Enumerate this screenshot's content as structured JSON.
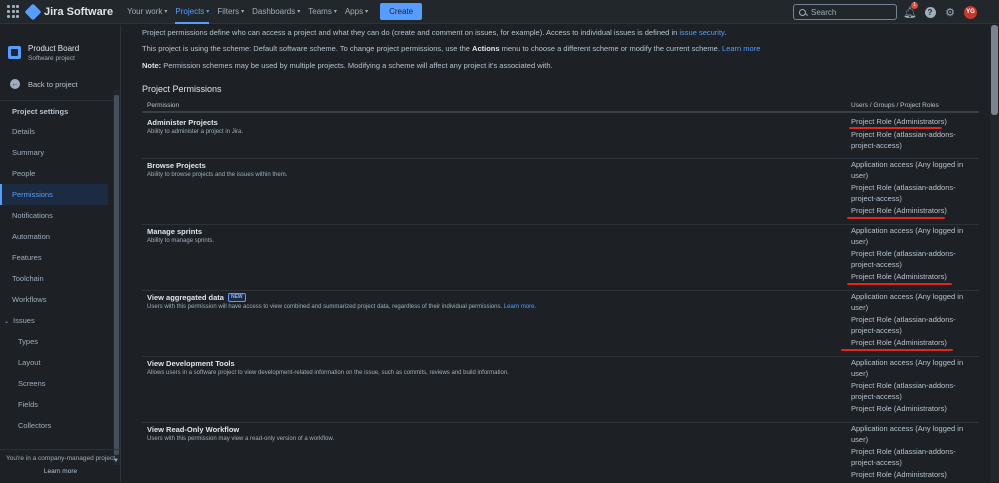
{
  "topnav": {
    "app_name": "Jira Software",
    "items": [
      {
        "label": "Your work"
      },
      {
        "label": "Projects"
      },
      {
        "label": "Filters"
      },
      {
        "label": "Dashboards"
      },
      {
        "label": "Teams"
      },
      {
        "label": "Apps"
      }
    ],
    "create_label": "Create",
    "search_placeholder": "Search",
    "notification_count": "1",
    "avatar_initials": "YG"
  },
  "sidebar": {
    "project_name": "Product Board",
    "project_type": "Software project",
    "back_label": "Back to project",
    "heading": "Project settings",
    "items": [
      {
        "label": "Details"
      },
      {
        "label": "Summary"
      },
      {
        "label": "People"
      },
      {
        "label": "Permissions"
      },
      {
        "label": "Notifications"
      },
      {
        "label": "Automation"
      },
      {
        "label": "Features"
      },
      {
        "label": "Toolchain"
      },
      {
        "label": "Workflows"
      },
      {
        "label": "Issues"
      },
      {
        "label": "Types"
      },
      {
        "label": "Layout"
      },
      {
        "label": "Screens"
      },
      {
        "label": "Fields"
      },
      {
        "label": "Collectors"
      }
    ],
    "footer_text": "You're in a company-managed project",
    "footer_link": "Learn more"
  },
  "main": {
    "intro1_a": "Project permissions define who can access a project and what they can do (create and comment on issues, for example). Access to individual issues is defined in ",
    "intro1_link": "issue security",
    "intro1_b": ".",
    "intro2_a": "This project is using the scheme: Default software scheme. To change project permissions, use the ",
    "intro2_bold": "Actions",
    "intro2_b": " menu to choose a different scheme or modify the current scheme. ",
    "intro2_link": "Learn more",
    "intro3_bold": "Note:",
    "intro3_b": " Permission schemes may be used by multiple projects. Modifying a scheme will affect any project it's associated with.",
    "section_title": "Project Permissions",
    "col_permission": "Permission",
    "col_roles": "Users / Groups / Project Roles",
    "permissions": [
      {
        "name": "Administer Projects",
        "desc": "Ability to administer a project in Jira.",
        "roles": [
          "Project Role (Administrators)",
          "Project Role (atlassian-addons-project-access)"
        ]
      },
      {
        "name": "Browse Projects",
        "desc": "Ability to browse projects and the issues within them.",
        "roles": [
          "Application access (Any logged in user)",
          "Project Role (atlassian-addons-project-access)",
          "Project Role (Administrators)"
        ]
      },
      {
        "name": "Manage sprints",
        "desc": "Ability to manage sprints.",
        "roles": [
          "Application access (Any logged in user)",
          "Project Role (atlassian-addons-project-access)",
          "Project Role (Administrators)"
        ]
      },
      {
        "name": "View aggregated data",
        "badge": "NEW",
        "desc": "Users with this permission will have access to view combined and summarized project data, regardless of their individual permissions.",
        "desc_link": "Learn more.",
        "roles": [
          "Application access (Any logged in user)",
          "Project Role (atlassian-addons-project-access)",
          "Project Role (Administrators)"
        ]
      },
      {
        "name": "View Development Tools",
        "desc": "Allows users in a software project to view development-related information on the issue, such as commits, reviews and build information.",
        "roles": [
          "Application access (Any logged in user)",
          "Project Role (atlassian-addons-project-access)",
          "Project Role (Administrators)"
        ]
      },
      {
        "name": "View Read-Only Workflow",
        "desc": "Users with this permission may view a read-only version of a workflow.",
        "roles": [
          "Application access (Any logged in user)",
          "Project Role (atlassian-addons-project-access)",
          "Project Role (Administrators)"
        ]
      }
    ]
  },
  "colors": {
    "accent": "#579dff",
    "annotation_red": "#e5251b",
    "background": "#1d2125"
  }
}
